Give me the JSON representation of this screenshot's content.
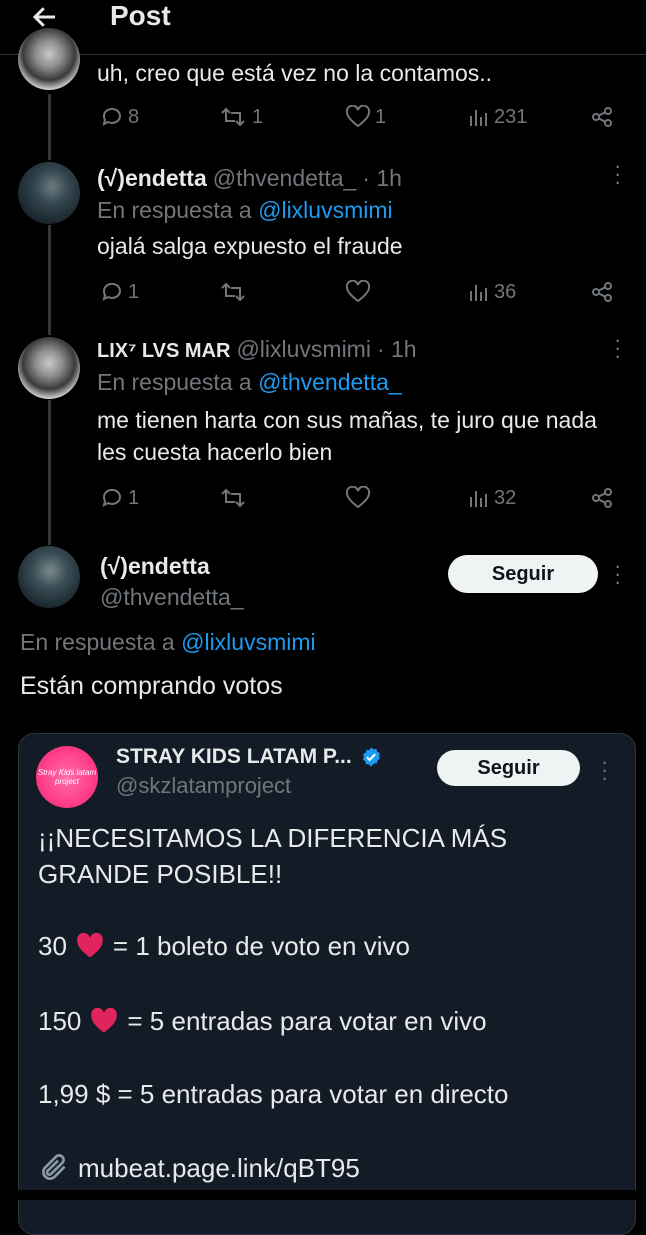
{
  "header": {
    "back_icon": "arrow-left-icon",
    "title": "Post"
  },
  "post1": {
    "text": "uh, creo que está vez no la contamos..",
    "replies": "8",
    "reposts": "1",
    "likes": "1",
    "views": "231"
  },
  "post2": {
    "name": "(√)endetta",
    "handle": "@thvendetta_",
    "time": "· 1h",
    "reply_prefix": "En respuesta a",
    "reply_to": "@lixluvsmimi",
    "text": "ojalá salga expuesto el fraude",
    "replies": "1",
    "reposts": "",
    "likes": "",
    "views": "36"
  },
  "post3": {
    "name": "LIX⁷ LVS MAR",
    "handle": "@lixluvsmimi",
    "time": "· 1h",
    "reply_prefix": "En respuesta a",
    "reply_to": "@thvendetta_",
    "text_line1": "me tienen harta con sus mañas, te juro que nada",
    "text_line2": "les cuesta hacerlo bien",
    "replies": "1",
    "reposts": "",
    "likes": "",
    "views": "32"
  },
  "main_post": {
    "name": "(√)endetta",
    "handle": "@thvendetta_",
    "follow_label": "Seguir",
    "reply_prefix": "En respuesta a",
    "reply_to": "@lixluvsmimi",
    "text": "Están comprando votos"
  },
  "quote": {
    "name": "STRAY KIDS LATAM P...",
    "handle": "@skzlatamproject",
    "follow_label": "Seguir",
    "avatar_text": "Stray Kids latam project",
    "line1": "¡¡NECESITAMOS LA DIFERENCIA MÁS",
    "line2": "GRANDE POSIBLE!!",
    "line3_num": "30",
    "line3_rest": "= 1 boleto de voto en vivo",
    "line4_num": "150",
    "line4_rest": "= 5 entradas para votar en vivo",
    "line5": "1,99 $ = 5 entradas para votar en directo",
    "link": "mubeat.page.link/qBT95"
  },
  "colors": {
    "accent": "#1d9bf0",
    "verified": "#1d9bf0",
    "heart": "#e0245e",
    "quote_bg": "#131c26"
  }
}
